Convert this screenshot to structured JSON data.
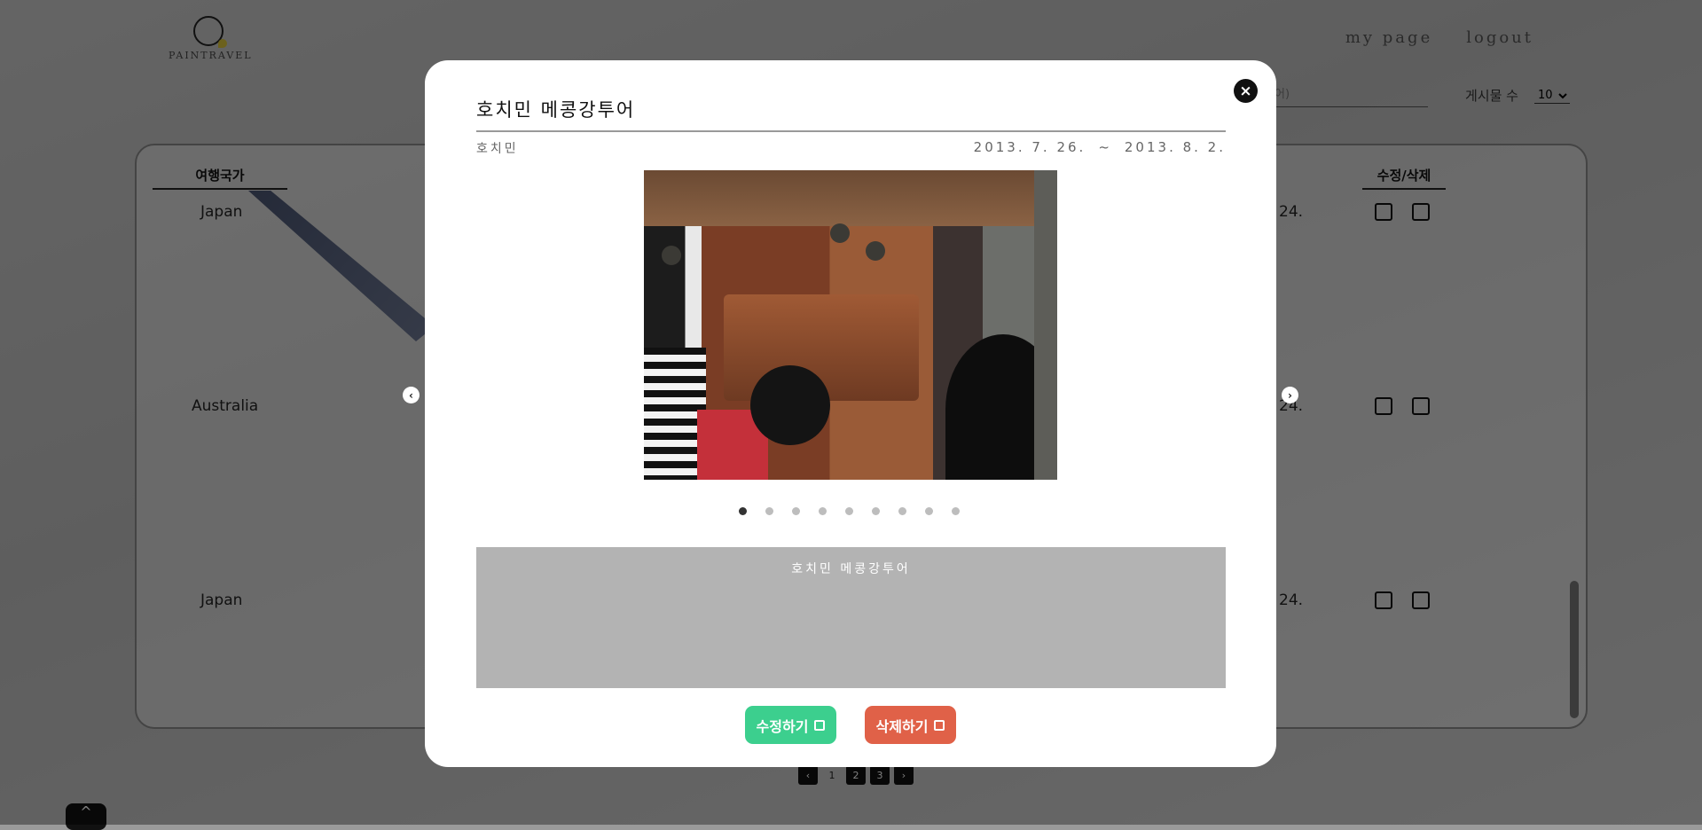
{
  "header": {
    "logo_text": "PAINTRAVEL",
    "nav": [
      "my page",
      "logout"
    ]
  },
  "filters": {
    "search_placeholder": "(영어)",
    "per_page_label": "게시물 수",
    "per_page_value": "10"
  },
  "table": {
    "columns": [
      "여행국가",
      "수정/삭제"
    ],
    "rows": [
      {
        "country": "Japan",
        "date_fragment": "24."
      },
      {
        "country": "Australia",
        "date_fragment": "24."
      },
      {
        "country": "Japan",
        "date_fragment": "24."
      }
    ]
  },
  "pagination": {
    "prev": "‹",
    "pages": [
      "1",
      "2",
      "3"
    ],
    "next": "›"
  },
  "modal": {
    "title": "호치민 메콩강투어",
    "city": "호치민",
    "date_start": "2013. 7. 26.",
    "date_sep": "~",
    "date_end": "2013. 8. 2.",
    "description": "호치민 메콩강투어",
    "carousel": {
      "slide_count": 9,
      "active_index": 0
    },
    "edit_label": "수정하기",
    "delete_label": "삭제하기",
    "close_symbol": "×",
    "prev_symbol": "‹",
    "next_symbol": "›"
  },
  "colors": {
    "edit": "#3ccf8e",
    "delete": "#e06148",
    "description_bg": "#b3b3b3"
  }
}
